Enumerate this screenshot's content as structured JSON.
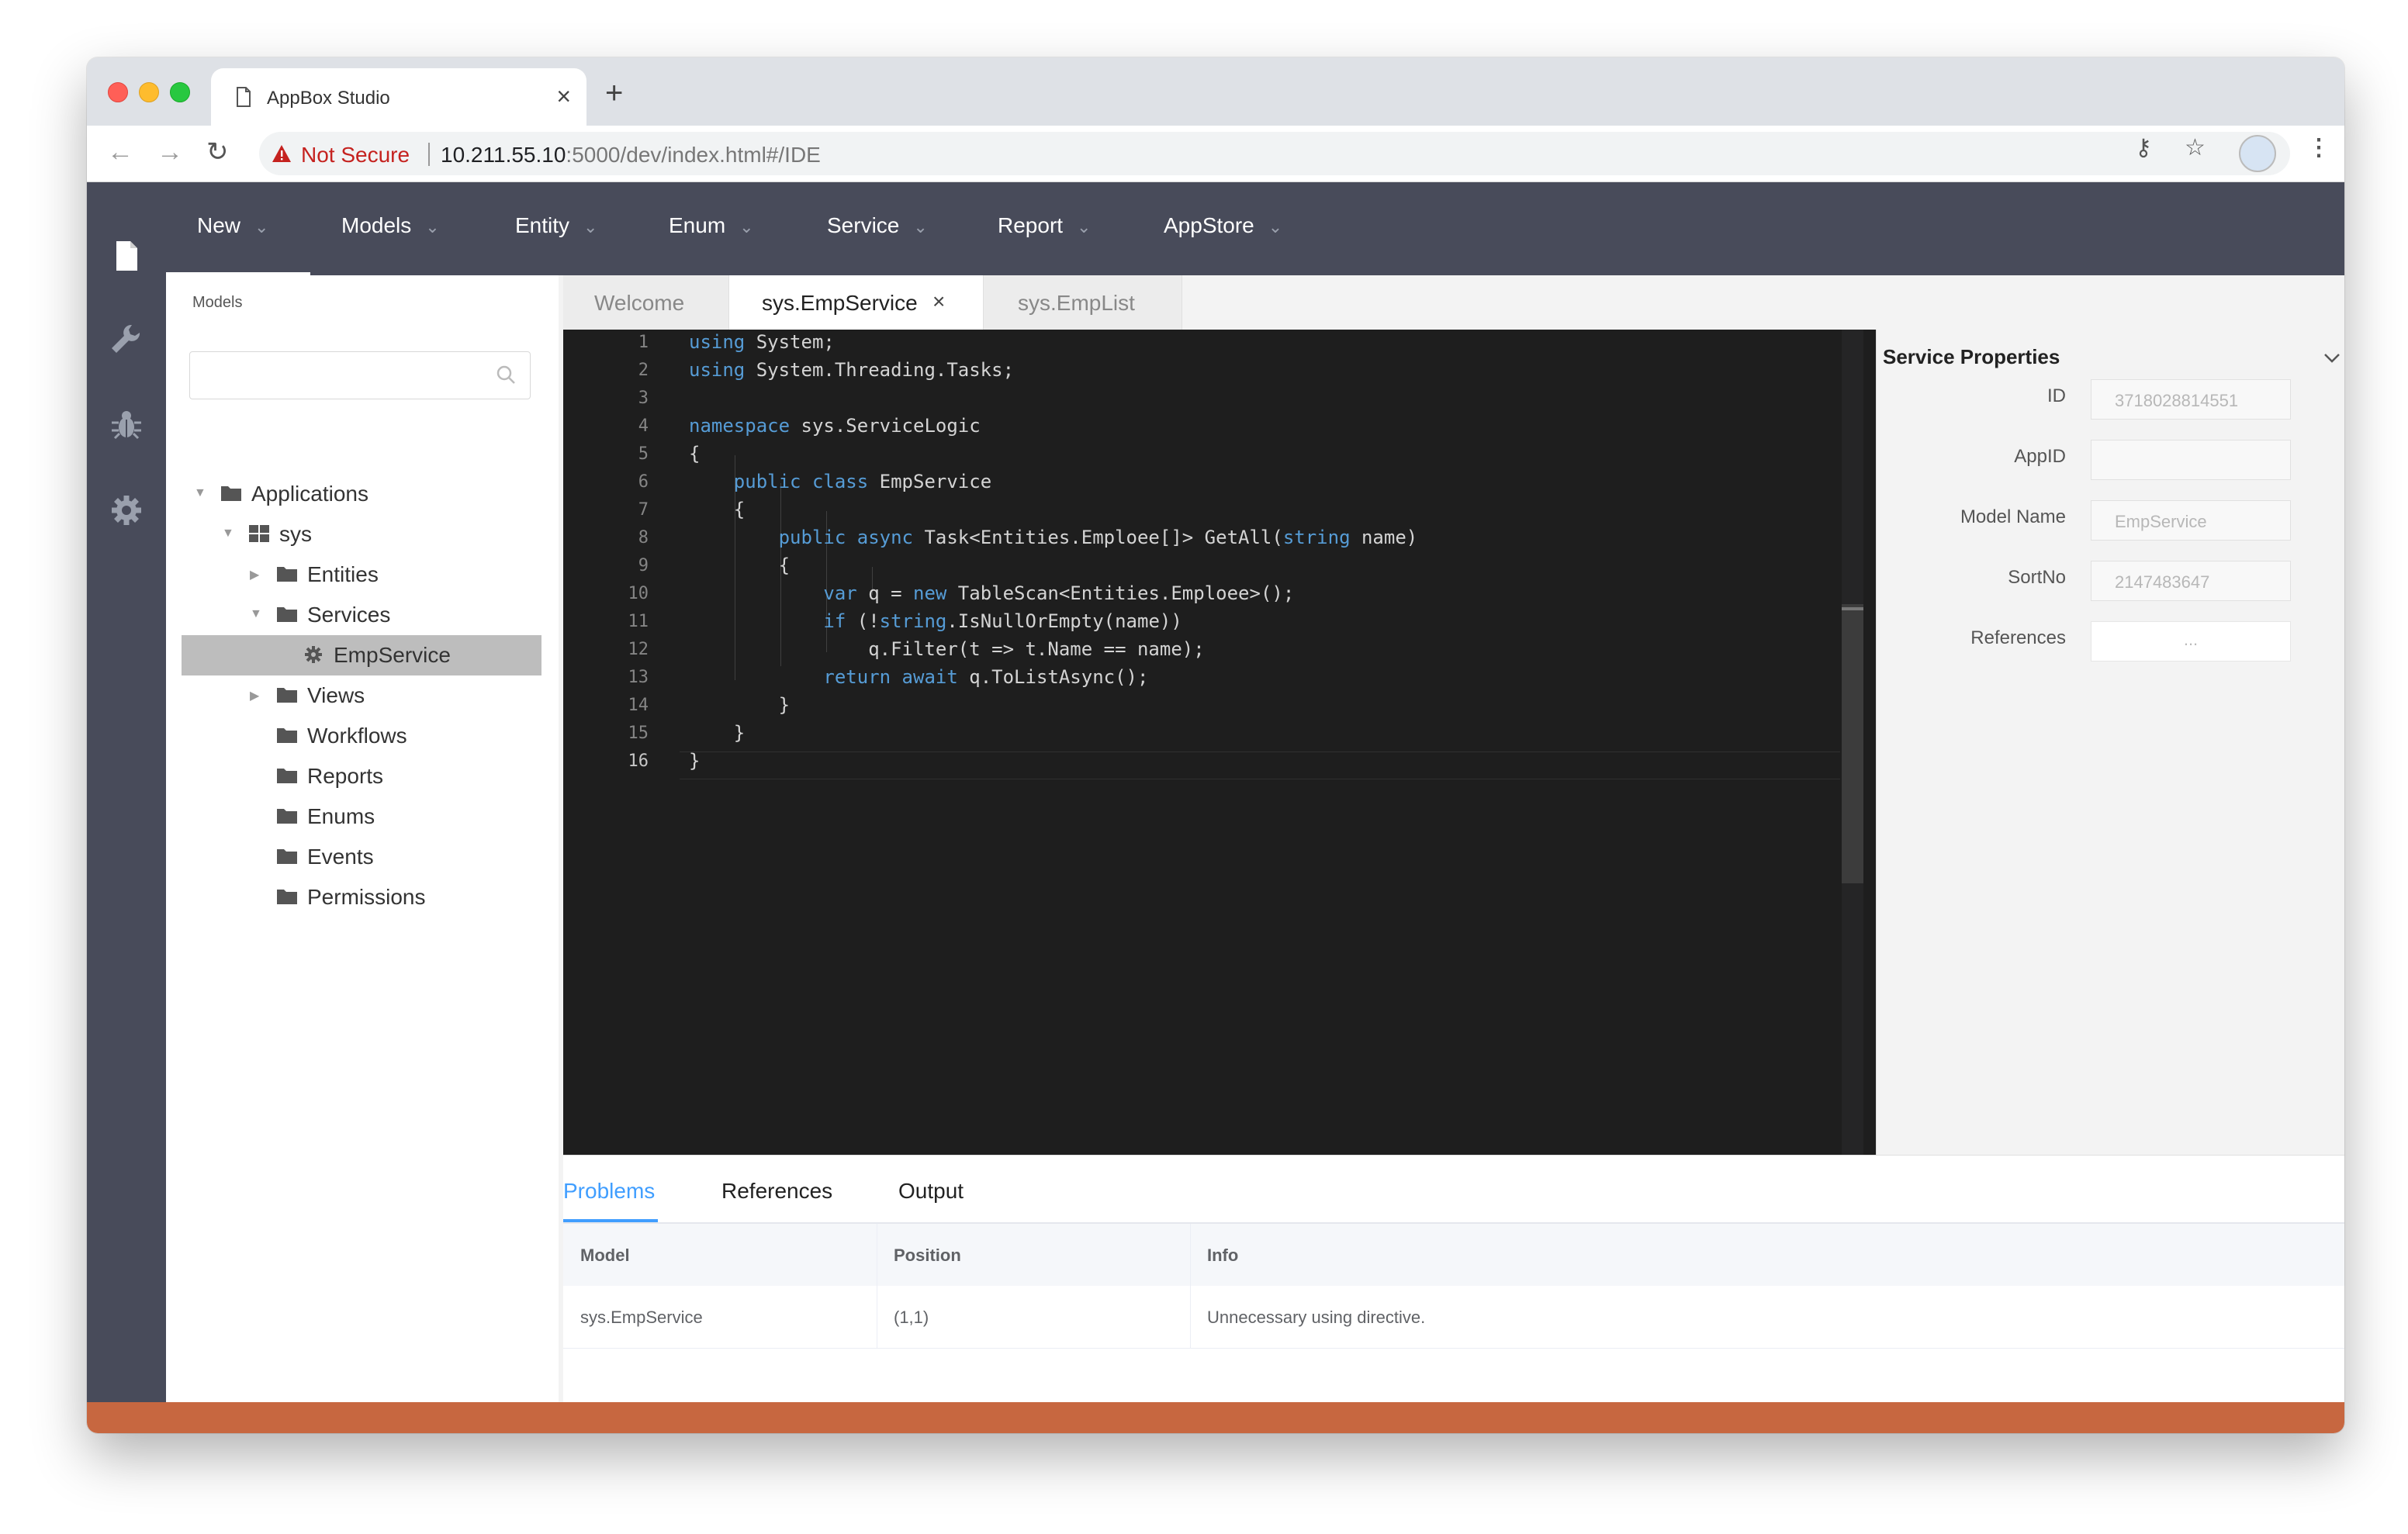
{
  "browser": {
    "tab_title": "AppBox Studio",
    "security_label": "Not Secure",
    "url_host": "10.211.55.10",
    "url_rest": ":5000/dev/index.html#/IDE"
  },
  "menu": [
    "New",
    "Models",
    "Entity",
    "Enum",
    "Service",
    "Report",
    "AppStore"
  ],
  "sidebar_icons": [
    "file-icon",
    "wrench-icon",
    "bug-icon",
    "gear-icon"
  ],
  "tree": {
    "panel_label": "Models",
    "search_value": "",
    "nodes": [
      {
        "label": "Applications",
        "expanded": true
      },
      {
        "label": "sys",
        "expanded": true
      },
      {
        "label": "Entities",
        "expanded": false
      },
      {
        "label": "Services",
        "expanded": true
      },
      {
        "label": "EmpService",
        "selected": true
      },
      {
        "label": "Views",
        "expanded": false
      },
      {
        "label": "Workflows"
      },
      {
        "label": "Reports"
      },
      {
        "label": "Enums"
      },
      {
        "label": "Events"
      },
      {
        "label": "Permissions"
      }
    ]
  },
  "editor_tabs": [
    {
      "label": "Welcome",
      "active": false
    },
    {
      "label": "sys.EmpService",
      "active": true,
      "closable": true
    },
    {
      "label": "sys.EmpList",
      "active": false
    }
  ],
  "code_lines": [
    "using System;",
    "using System.Threading.Tasks;",
    "",
    "namespace sys.ServiceLogic",
    "{",
    "    public class EmpService",
    "    {",
    "        public async Task<Entities.Emploee[]> GetAll(string name)",
    "        {",
    "            var q = new TableScan<Entities.Emploee>();",
    "            if (!string.IsNullOrEmpty(name))",
    "                q.Filter(t => t.Name == name);",
    "            return await q.ToListAsync();",
    "        }",
    "    }",
    "}"
  ],
  "properties": {
    "title": "Service Properties",
    "fields": [
      {
        "label": "ID",
        "value": "3718028814551"
      },
      {
        "label": "AppID",
        "value": ""
      },
      {
        "label": "Model Name",
        "value": "EmpService"
      },
      {
        "label": "SortNo",
        "value": "2147483647"
      },
      {
        "label": "References",
        "value": "..."
      }
    ]
  },
  "bottom_panel": {
    "tabs": [
      "Problems",
      "References",
      "Output"
    ],
    "active_tab": "Problems",
    "columns": [
      "Model",
      "Position",
      "Info"
    ],
    "rows": [
      {
        "model": "sys.EmpService",
        "position": "(1,1)",
        "info": "Unnecessary using directive."
      }
    ]
  },
  "colors": {
    "app_dark": "#484b5a",
    "accent": "#409eff",
    "status_bar": "#c76740",
    "editor_bg": "#1e1e1e",
    "keyword": "#569cd6"
  }
}
